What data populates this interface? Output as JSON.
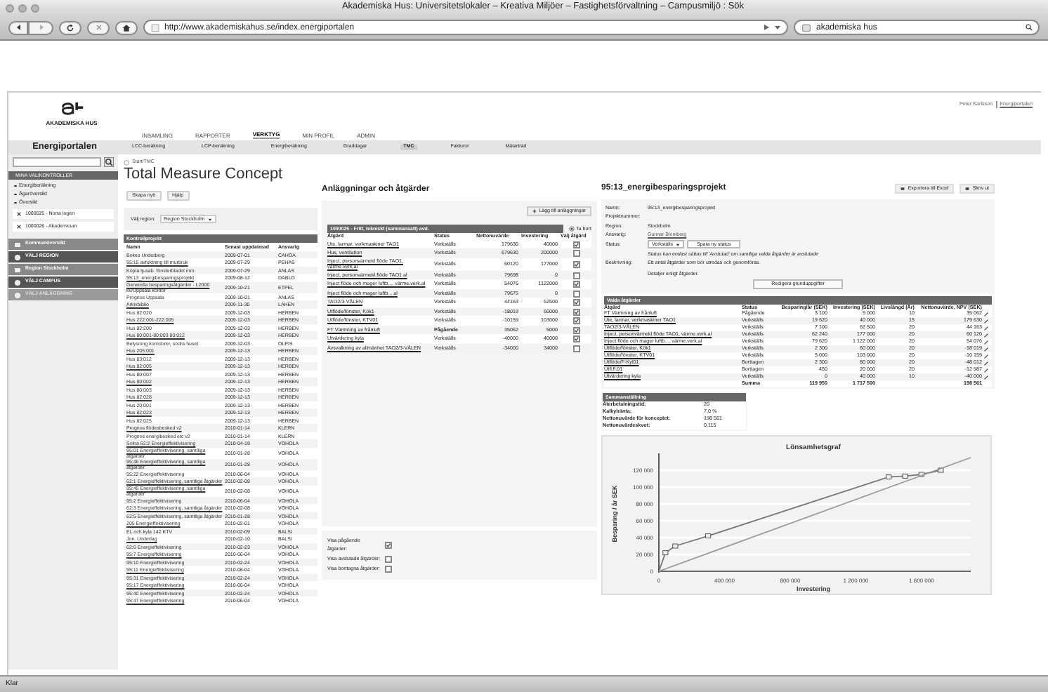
{
  "window": {
    "title": "Akademiska Hus: Universitetslokaler – Kreativa Miljöer – Fastighetsförvaltning – Campusmiljö : Sök"
  },
  "toolbar": {
    "url": "http://www.akademiskahus.se/index.energiportalen",
    "search": "akademiska hus"
  },
  "header": {
    "logo_text": "AKADEMISKA HUS",
    "user": "Peter Karlsson",
    "user_link": "Energiportalen",
    "nav": [
      {
        "label": "INSAMLING",
        "selected": false
      },
      {
        "label": "RAPPORTER",
        "selected": false
      },
      {
        "label": "VERKTYG",
        "selected": true
      },
      {
        "label": "MIN PROFIL",
        "selected": false
      },
      {
        "label": "ADMIN",
        "selected": false
      }
    ],
    "portal": "Energiportalen",
    "subnav": [
      {
        "label": "LCC-beräkning",
        "selected": false
      },
      {
        "label": "LCP-beräkning",
        "selected": false
      },
      {
        "label": "Energiberäkning",
        "selected": false
      },
      {
        "label": "Graddagar",
        "selected": false
      },
      {
        "label": "TMC",
        "selected": true
      },
      {
        "label": "Fakturor",
        "selected": false
      },
      {
        "label": "Mätarträd",
        "selected": false
      }
    ]
  },
  "sidebar": {
    "heading": "MINA VAL/KONTROLLER",
    "links": [
      "Energiberäkning",
      "Ägaröversikt",
      "Översikt"
    ],
    "recent": [
      "1000025 - Norra logen",
      "1000026 - Akademicum"
    ],
    "sections": [
      {
        "label": "Kommunöversikt",
        "kind": "page",
        "disabled": false
      },
      {
        "label": "VÄLJ REGION",
        "kind": "step",
        "disabled": false
      },
      {
        "label": "Region Stockholm",
        "kind": "page",
        "disabled": false
      },
      {
        "label": "VÄLJ CAMPUS",
        "kind": "step",
        "disabled": false
      },
      {
        "label": "VÄLJ ANLÄGGNING",
        "kind": "step",
        "disabled": true
      }
    ]
  },
  "breadcrumb": "Start/TMC",
  "page_title": "Total Measure Concept",
  "actions": [
    "Skapa nytt",
    "Hjälp"
  ],
  "region": {
    "label": "Välj region:",
    "value": "Region Stockholm"
  },
  "projects": {
    "title": "Kontrollprojekt",
    "columns": [
      "Namn",
      "Senast uppdaterad",
      "Ansvarig"
    ],
    "rows": [
      [
        "Bokes Underberg",
        "2009-07-01",
        "CAHOA"
      ],
      [
        "95:15 avfuktning till murbruk",
        "2009-07-29",
        "PEHAS"
      ],
      [
        "Köpta ljusab. fönsterbladet mm",
        "2009-07-29",
        "ANLAS"
      ],
      [
        "95:13_energibesparingsprojekt",
        "2009-08-12",
        "DABLO"
      ],
      [
        "Generella besparingsåtgärder - L2000 kv/Uppsala kontor",
        "2009-10-21",
        "ETPEL"
      ],
      [
        "Prognos Uppsala",
        "2009-10-01",
        "ANLAS"
      ],
      [
        "Arkivbiblio",
        "2009-11-30",
        "LAHEN"
      ],
      [
        "Hus 82:020",
        "2009-12-03",
        "HERBEN"
      ],
      [
        "Hus 222:001-222:005",
        "2009-12-03",
        "HERBEN"
      ],
      [
        "Hus 82:200",
        "2009-12-03",
        "HERBEN"
      ],
      [
        "Hus 80:001-80:003 80:012",
        "2009-12-03",
        "HERBEN"
      ],
      [
        "Belysning korridorer, södra huset",
        "2009-12-03",
        "OLPIS"
      ],
      [
        "Hus 205:001",
        "2009-12-13",
        "HERBEN"
      ],
      [
        "Hus 83:012",
        "2009-12-13",
        "HERBEN"
      ],
      [
        "Hus 82:005",
        "2009-12-13",
        "HERBEN"
      ],
      [
        "Hus 80:007",
        "2009-12-13",
        "HERBEN"
      ],
      [
        "Hus 80:002",
        "2009-12-13",
        "HERBEN"
      ],
      [
        "Hus 80:003",
        "2009-12-13",
        "HERBEN"
      ],
      [
        "Hus 82:028",
        "2009-12-13",
        "HERBEN"
      ],
      [
        "Hus 20:001",
        "2009-12-13",
        "HERBEN"
      ],
      [
        "Hus 82:023",
        "2009-12-13",
        "HERBEN"
      ],
      [
        "Hus 82:025",
        "2009-12-13",
        "HERBEN"
      ],
      [
        "Prognos flödesbesked v2",
        "2010-01-14",
        "KLERN"
      ],
      [
        "Prognos energibesked etc v2",
        "2010-01-14",
        "KLERN"
      ],
      [
        "Solna 62:2 Energieffektivisering",
        "2010-04-19",
        "VOHOLA"
      ],
      [
        "95:01 Energieffektivisering, samtliga åtgärder",
        "2010-01-28",
        "VOHOLA"
      ],
      [
        "95:46 Energieffektivisering, samtliga åtgärder",
        "2010-01-28",
        "VOHOLA"
      ],
      [
        "95:22 Energieffektivisering",
        "2010-06-04",
        "VOHOLA"
      ],
      [
        "62:1 Energieffektivisering, samtliga åtgärder",
        "2010-02-08",
        "VOHOLA"
      ],
      [
        "95:45 Energieffektivisering, samtliga åtgärder",
        "2010-02-08",
        "VOHOLA"
      ],
      [
        "95:2 Energieffektivisering",
        "2010-06-04",
        "VOHOLA"
      ],
      [
        "62:3 Energieffektivisering, samtliga åtgärder",
        "2010-02-08",
        "VOHOLA"
      ],
      [
        "62:5 Energieffektivisering, samtliga åtgärder",
        "2010-01-28",
        "VOHOLA"
      ],
      [
        "205 Energieffektivisering",
        "2010-02-01",
        "VOHOLA"
      ],
      [
        "EL och kyla 142 KTV",
        "2010-02-09",
        "BALSI"
      ],
      [
        "Jon. Underlag",
        "2010-02-10",
        "BALSI"
      ],
      [
        "62:6 Energieffektivisering",
        "2010-02-23",
        "VOHOLA"
      ],
      [
        "95:7 Energieffektivisering",
        "2010-06-04",
        "VOHOLA"
      ],
      [
        "95:10 Energieffektivisering",
        "2010-02-24",
        "VOHOLA"
      ],
      [
        "95:11 Energieffektivisering",
        "2010-06-04",
        "VOHOLA"
      ],
      [
        "95:31 Energieffektivisering",
        "2010-02-24",
        "VOHOLA"
      ],
      [
        "95:17 Energieffektivisering",
        "2010-06-04",
        "VOHOLA"
      ],
      [
        "95:40 Energieffektivisering",
        "2010-02-24",
        "VOHOLA"
      ],
      [
        "95:47 Energieffektivisering",
        "2010-06-04",
        "VOHOLA"
      ]
    ]
  },
  "facilities": {
    "title": "Anläggningar och åtgärder",
    "add_button": "Lägg till anläggningar",
    "table_title": "1000025 - Fritt, tekniskt (sammansatt) avd.",
    "remove": "Ta bort",
    "columns": [
      "Åtgärd",
      "Status",
      "Nettonuvärde",
      "Investering",
      "Välj åtgärd"
    ],
    "rows": [
      {
        "name": "Ute, larmar, verkmaskiner TAO1",
        "status": "Verkställs",
        "npv": "179630",
        "investment": "40000",
        "checked": true
      },
      {
        "name": "Hus, ventilation",
        "status": "Verkställs",
        "npv": "679630",
        "investment": "200000",
        "checked": false
      },
      {
        "name": "Inject, personvärmekl.flöde TAO1, värme.verk.al",
        "status": "Verkställs",
        "npv": "60120",
        "investment": "177000",
        "checked": true
      },
      {
        "name": "Inject, personvärmekl.flöde TAO1 al",
        "status": "Verkställs",
        "npv": "79698",
        "investment": "0",
        "checked": false
      },
      {
        "name": "Inject flöde och mager luftb..., värme.verk.al",
        "status": "Verkställs",
        "npv": "54076",
        "investment": "1122000",
        "checked": true
      },
      {
        "name": "Inject flöde och mager luftb... al",
        "status": "Verkställs",
        "npv": "79675",
        "investment": "0",
        "checked": false
      },
      {
        "name": "TAO2/3-VÅLEN",
        "status": "Verkställs",
        "npv": "44163",
        "investment": "62500",
        "checked": true
      },
      {
        "name": "Utflöde/fönster, Kök1",
        "status": "Verkställs",
        "npv": "-18019",
        "investment": "60000",
        "checked": true
      },
      {
        "name": "Utflöde/fönster, KTV01",
        "status": "Verkställs",
        "npv": "-10159",
        "investment": "103000",
        "checked": true
      },
      {
        "name": "FT Värmning av frånluft",
        "status": "Pågående",
        "npv": "35062",
        "investment": "5000",
        "checked": true
      },
      {
        "name": "Utvärdering kyla",
        "status": "Verkställs",
        "npv": "-40000",
        "investment": "40000",
        "checked": true
      },
      {
        "name": "Avsvalkning av allmänhet TAO2/3-VÅLEN",
        "status": "Verkställs",
        "npv": "-34000",
        "investment": "34000",
        "checked": false
      }
    ],
    "filters": [
      {
        "label": "Visa pågående åtgärder:",
        "checked": true
      },
      {
        "label": "Visa avslutade åtgärder:",
        "checked": false
      },
      {
        "label": "Visa borttagna åtgärder:",
        "checked": false
      }
    ]
  },
  "project": {
    "title": "95:13_energibesparingsprojekt",
    "buttons": [
      "Exportera till Excel",
      "Skriv ut"
    ],
    "fields": [
      {
        "label": "Namn:",
        "value": "95:13_energibesparingsprojekt",
        "kind": "text"
      },
      {
        "label": "Projektnummer:",
        "kind": "text"
      },
      {
        "label": "Region:",
        "value": "Stockholm",
        "kind": "text"
      },
      {
        "label": "Ansvarig:",
        "value": "Gunnar Blomberg",
        "kind": "link"
      },
      {
        "label": "Status:",
        "value": "Verkställs",
        "button": "Spara ny status",
        "kind": "status"
      }
    ],
    "note": "Status kan endast sättas till 'Avslutad' om samtliga valda åtgärder är avslutade",
    "description_label": "Beskrivning:",
    "description": "Ett antal åtgärder som bör utredas och genomföras.",
    "details": "Detaljer enligt åtgärder.",
    "edit_button": "Redigera grunduppgifter",
    "selected": {
      "title": "Valda åtgärder",
      "columns": [
        "Åtgärd",
        "Status",
        "Besparing/år (SEK)",
        "Investering (SEK)",
        "Livslängd (År)",
        "Nettonuvärde, NPV (SEK)"
      ],
      "rows": [
        [
          "FT Värmning av frånluft",
          "Pågående",
          "3 100",
          "5 000",
          "10",
          "35 062"
        ],
        [
          "Ute, larmar, verkmaskiner TAO1",
          "Verkställs",
          "19 620",
          "40 000",
          "15",
          "179 630"
        ],
        [
          "TAO2/3-VÅLEN",
          "Verkställs",
          "7 100",
          "62 500",
          "20",
          "44 163"
        ],
        [
          "Inject, personvärmekl.flöde TAO1, värme.verk.al",
          "Verkställs",
          "62 240",
          "177 000",
          "20",
          "60 120"
        ],
        [
          "Inject flöde och mager luftb..., värme.verk.al",
          "Verkställs",
          "79 620",
          "1 122 000",
          "20",
          "54 076"
        ],
        [
          "Utflöde/fönster, Kök1",
          "Verkställs",
          "2 300",
          "60 000",
          "20",
          "-18 019"
        ],
        [
          "Utflöde/fönster, KTV01",
          "Verkställs",
          "5 000",
          "103 000",
          "20",
          "-10 159"
        ],
        [
          "Utflöde/F-Kyl01",
          "Borttagen",
          "2 300",
          "80 000",
          "20",
          "-48 012"
        ],
        [
          "Utfl.fl.01",
          "Borttagen",
          "450",
          "20 000",
          "20",
          "-12 987"
        ],
        [
          "Utvärdering kyla",
          "Verkställs",
          "0",
          "40 000",
          "10",
          "-40 000"
        ]
      ],
      "total": [
        "Summa",
        "119 950",
        "1 717 500",
        "198 561"
      ]
    },
    "summary": {
      "title": "Sammanställning",
      "rows": [
        [
          "Återbetalningstid:",
          "20"
        ],
        [
          "Kalkylränta:",
          "7,0 %"
        ],
        [
          "Nettonuvärde för konceptet:",
          "198 561"
        ],
        [
          "Nettonuvärdeskvot:",
          "0,115"
        ]
      ]
    },
    "chart_data": {
      "type": "line",
      "title": "Lönsamhetsgraf",
      "xlabel": "Investering",
      "ylabel": "Besparing / år SEK",
      "x": [
        0,
        40000,
        100000,
        300000,
        1400000,
        1500000,
        1600000,
        1717500,
        1900000
      ],
      "series": [
        {
          "color": "#777777",
          "marker": "square",
          "values": [
            0,
            22000,
            30000,
            42000,
            112000,
            113000,
            115000,
            120000,
            null
          ]
        },
        {
          "color": "#999999",
          "values": [
            0,
            null,
            null,
            null,
            null,
            null,
            null,
            null,
            135000
          ]
        }
      ],
      "xlim": [
        0,
        1900000
      ],
      "ylim": [
        0,
        140000
      ],
      "grid": true,
      "xticks": [
        {
          "value": 0,
          "label": "0"
        },
        {
          "value": 400000,
          "label": "400 000"
        },
        {
          "value": 800000,
          "label": "800 000"
        },
        {
          "value": 1200000,
          "label": "1 200 000"
        },
        {
          "value": 1600000,
          "label": "1 600 000"
        }
      ],
      "yticks": [
        {
          "value": 0,
          "label": "0"
        },
        {
          "value": 20000,
          "label": "20 000"
        },
        {
          "value": 40000,
          "label": "40 000"
        },
        {
          "value": 60000,
          "label": "60 000"
        },
        {
          "value": 80000,
          "label": "80 000"
        },
        {
          "value": 100000,
          "label": "100 000"
        },
        {
          "value": 120000,
          "label": "120 000"
        }
      ]
    }
  },
  "status_bar": "Klar"
}
